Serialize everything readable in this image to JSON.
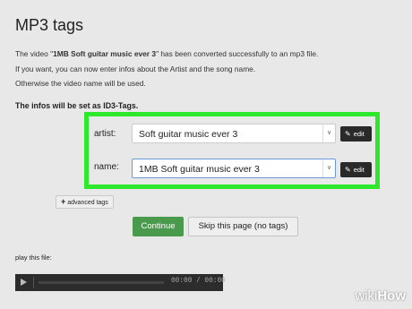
{
  "page": {
    "title": "MP3 tags"
  },
  "intro": {
    "line1_pre": "The video \"",
    "line1_bold": "1MB Soft guitar music ever 3",
    "line1_post": "\" has been converted successfully to an mp3 file.",
    "line2": "If you want, you can now enter infos about the Artist and the song name.",
    "line3": "Otherwise the video name will be used."
  },
  "section_label": "The infos will be set as ID3-Tags.",
  "form": {
    "artist": {
      "label": "artist:",
      "value": "Soft guitar music ever 3",
      "edit_label": "edit"
    },
    "name": {
      "label": "name:",
      "value": "1MB Soft guitar music ever 3",
      "edit_label": "edit"
    },
    "highlight_color": "#2ee82e"
  },
  "buttons": {
    "advanced_tags": "advanced tags",
    "continue": "Continue",
    "skip": "Skip this page (no tags)"
  },
  "player": {
    "label": "play this file:",
    "time": "00:00 / 00:00"
  },
  "watermark": {
    "wiki": "wiki",
    "how": "How"
  },
  "colors": {
    "continue_bg": "#4a9a4e",
    "edit_bg": "#2a2a2a"
  }
}
